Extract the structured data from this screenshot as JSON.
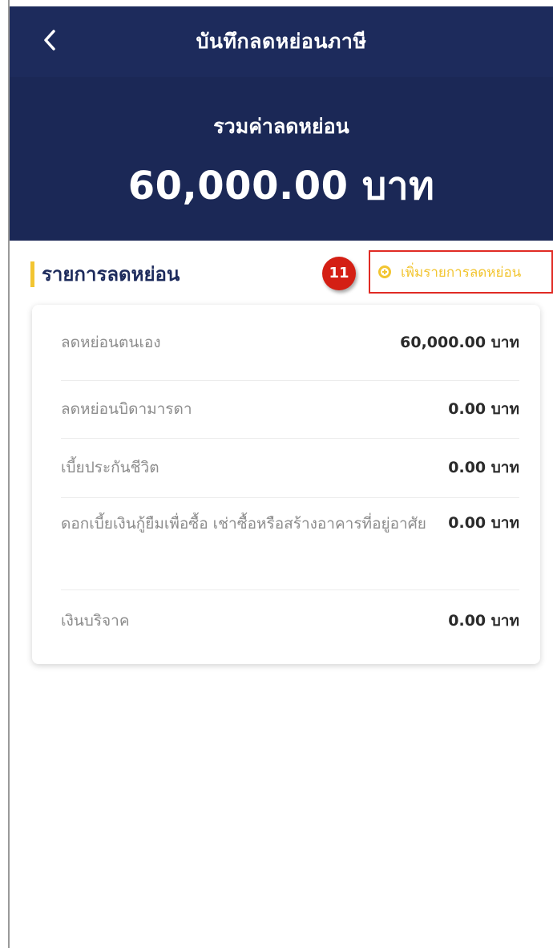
{
  "header": {
    "title": "บันทึกลดหย่อนภาษี"
  },
  "summary": {
    "label": "รวมค่าลดหย่อน",
    "amount": "60,000.00 บาท"
  },
  "section": {
    "title": "รายการลดหย่อน",
    "marker": "11",
    "add_label": "เพิ่มรายการลดหย่อน"
  },
  "deductions": [
    {
      "name": "ลดหย่อนตนเอง",
      "value": "60,000.00 บาท"
    },
    {
      "name": "ลดหย่อนบิดามารดา",
      "value": "0.00 บาท"
    },
    {
      "name": "เบี้ยประกันชีวิต",
      "value": "0.00 บาท"
    },
    {
      "name": "ดอกเบี้ยเงินกู้ยืมเพื่อซื้อ เช่าซื้อหรือสร้างอาคารที่อยู่อาศัย",
      "value": "0.00 บาท"
    },
    {
      "name": "เงินบริจาค",
      "value": "0.00 บาท"
    }
  ],
  "colors": {
    "header_bg": "#1d2b5c",
    "accent": "#f2c531",
    "highlight_border": "#e02b24",
    "marker": "#d41f14"
  },
  "icons": {
    "back": "chevron-left-icon",
    "add": "plus-circle-icon"
  }
}
